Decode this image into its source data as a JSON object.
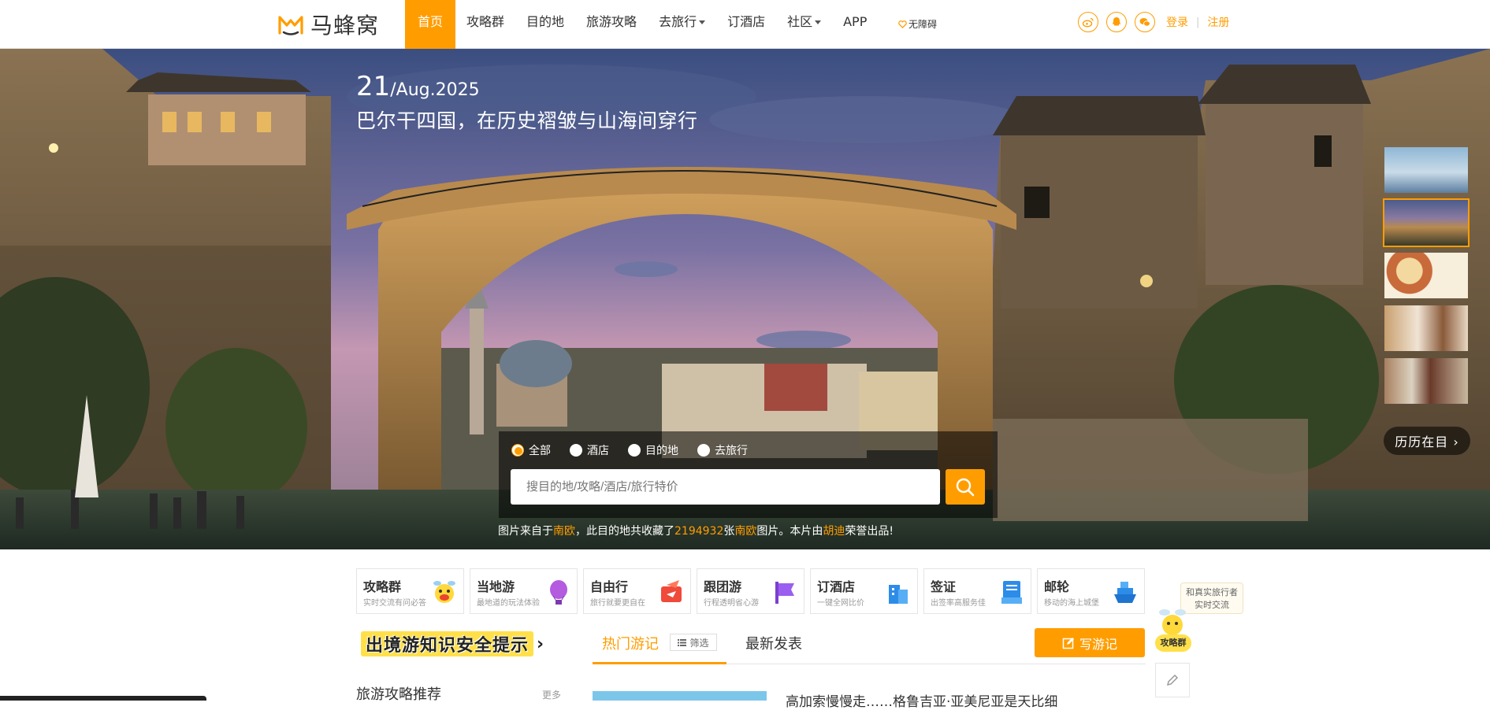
{
  "header": {
    "logo_text": "马蜂窝",
    "nav": [
      {
        "label": "首页",
        "active": true
      },
      {
        "label": "攻略群"
      },
      {
        "label": "目的地"
      },
      {
        "label": "旅游攻略"
      },
      {
        "label": "去旅行",
        "dropdown": true
      },
      {
        "label": "订酒店"
      },
      {
        "label": "社区",
        "dropdown": true
      },
      {
        "label": "APP"
      }
    ],
    "accessibility": "无障碍",
    "login": "登录",
    "register": "注册",
    "social_icons": [
      "weibo-icon",
      "qq-icon",
      "wechat-icon"
    ]
  },
  "hero": {
    "day": "21",
    "date_rest": "/Aug.2025",
    "title": "巴尔干四国，在历史褶皱与山海间穿行",
    "li_badge": "历历在目 ›",
    "search": {
      "options": [
        "全部",
        "酒店",
        "目的地",
        "去旅行"
      ],
      "selected": "全部",
      "placeholder": "搜目的地/攻略/酒店/旅行特价"
    },
    "credit": {
      "p1": "图片来自于",
      "place": "南欧",
      "p2": "，此目的地共收藏了",
      "count": "2194932",
      "p3": "张",
      "place2": "南欧",
      "p4": "图片。本片由",
      "author": "胡迪",
      "p5": "荣誉出品!"
    }
  },
  "services": [
    {
      "title": "攻略群",
      "sub": "实时交流有问必答"
    },
    {
      "title": "当地游",
      "sub": "最地道的玩法体验"
    },
    {
      "title": "自由行",
      "sub": "旅行就要更自在"
    },
    {
      "title": "跟团游",
      "sub": "行程透明省心游"
    },
    {
      "title": "订酒店",
      "sub": "一键全网比价"
    },
    {
      "title": "签证",
      "sub": "出签率高服务佳"
    },
    {
      "title": "邮轮",
      "sub": "移动的海上城堡"
    }
  ],
  "floater": {
    "bubble_l1": "和真实旅行者",
    "bubble_l2": "实时交流",
    "label": "攻略群"
  },
  "tip_banner": "出境游知识安全提示",
  "tabs": {
    "hot": "热门游记",
    "filter": "筛选",
    "latest": "最新发表"
  },
  "write_btn": "写游记",
  "recommend": "旅游攻略推荐",
  "more": "更多",
  "article_snippet": "高加索慢慢走……格鲁吉亚·亚美尼亚是天比细",
  "colors": {
    "accent": "#ff9d00",
    "card_border": "#e5e5e5"
  }
}
